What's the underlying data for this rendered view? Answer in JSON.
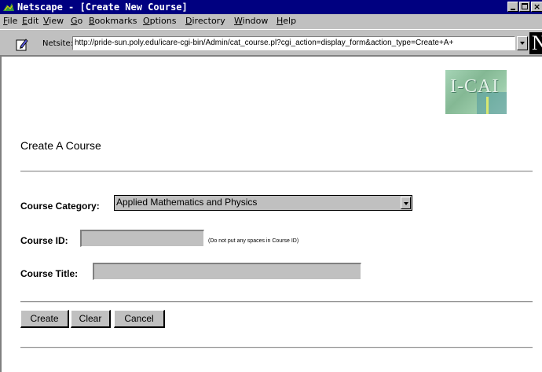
{
  "window": {
    "title": "Netscape - [Create New Course]"
  },
  "menu": [
    {
      "pre": "",
      "ul": "F",
      "post": "ile"
    },
    {
      "pre": "",
      "ul": "E",
      "post": "dit"
    },
    {
      "pre": "",
      "ul": "V",
      "post": "iew"
    },
    {
      "pre": "",
      "ul": "G",
      "post": "o"
    },
    {
      "pre": "",
      "ul": "B",
      "post": "ookmarks"
    },
    {
      "pre": "",
      "ul": "O",
      "post": "ptions"
    },
    {
      "pre": "",
      "ul": "D",
      "post": "irectory"
    },
    {
      "pre": "",
      "ul": "W",
      "post": "indow"
    },
    {
      "pre": "",
      "ul": "H",
      "post": "elp"
    }
  ],
  "location": {
    "label": "Netsite:",
    "url": "http://pride-sun.poly.edu/icare-cgi-bin/Admin/cat_course.pl?cgi_action=display_form&action_type=Create+A+"
  },
  "logo": {
    "netscape_letter": "N",
    "icare_text": "I-CAI"
  },
  "page": {
    "heading": "Create A Course"
  },
  "form": {
    "category_label": "Course Category:",
    "category_value": "Applied Mathematics and Physics",
    "id_label": "Course ID:",
    "id_value": "",
    "id_hint": "(Do not put any spaces in Course ID)",
    "title_label": "Course Title:",
    "title_value": ""
  },
  "buttons": {
    "create": "Create",
    "clear": "Clear",
    "cancel": "Cancel"
  },
  "colors": {
    "titlebar": "#000080",
    "chrome": "#c0c0c0"
  },
  "icons": {
    "app": "netscape-app-icon",
    "edit": "edit-pencil-icon"
  }
}
